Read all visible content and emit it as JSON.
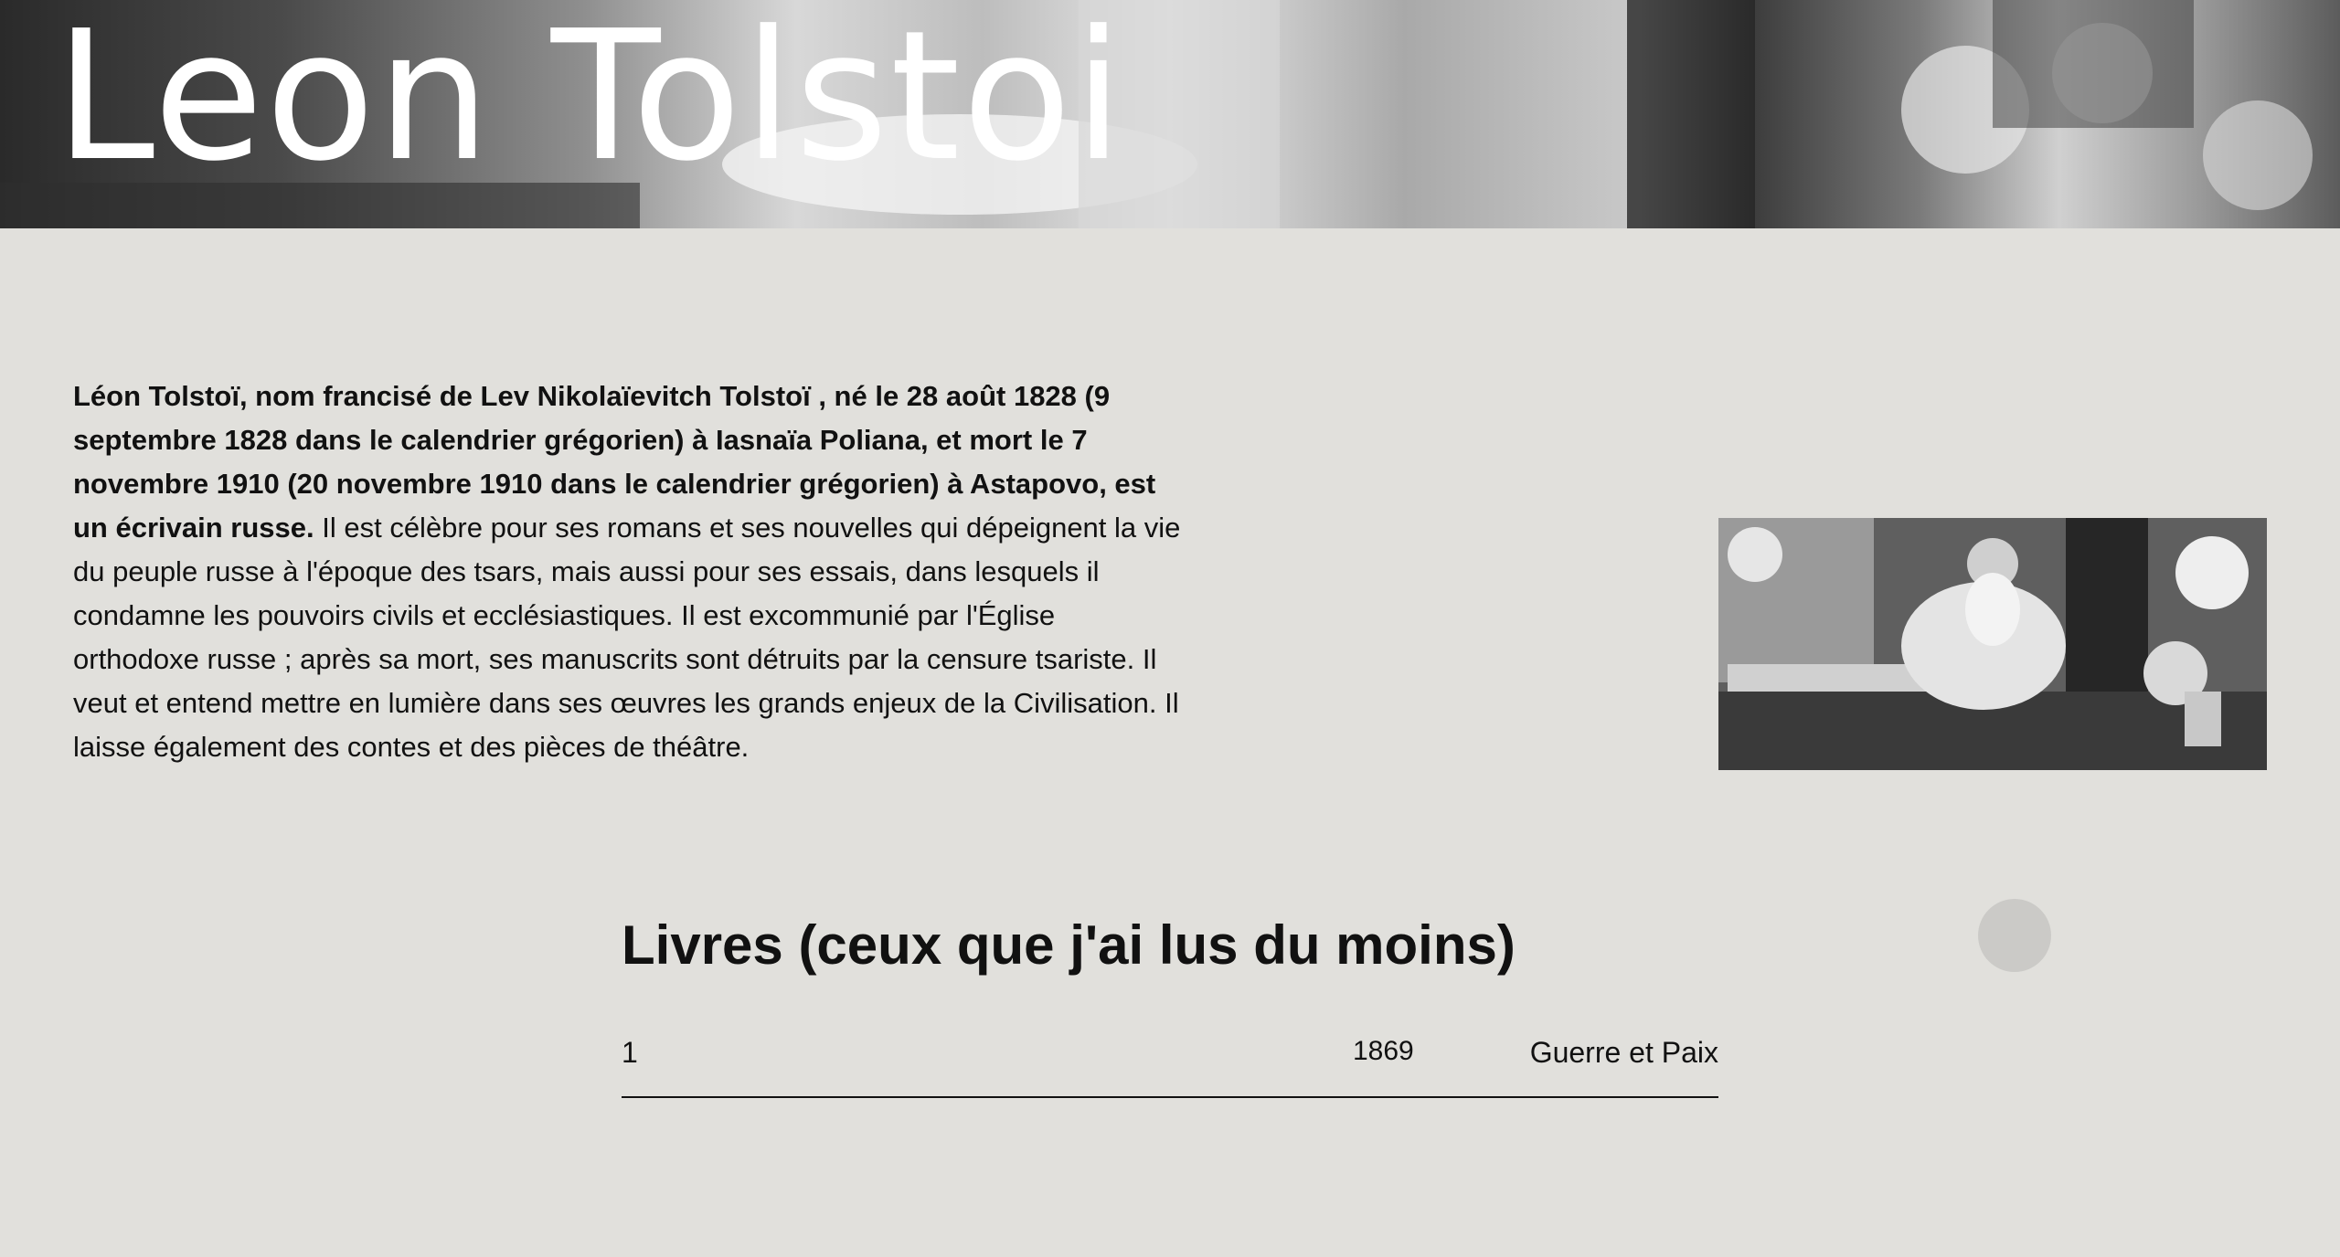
{
  "hero": {
    "title": "Leon Tolstoi"
  },
  "bio": {
    "intro_bold": "Léon Tolstoï, nom francisé de Lev Nikolaïevitch Tolstoï , né le 28 août 1828 (9 septembre 1828 dans le calendrier grégorien) à Iasnaïa Poliana, et mort le 7 novembre 1910 (20 novembre 1910 dans le calendrier grégorien) à Astapovo, est un écrivain russe.",
    "body": " Il est célèbre pour ses romans et ses nouvelles qui dépeignent la vie du peuple russe à l'époque des tsars, mais aussi pour ses essais, dans lesquels il condamne les pouvoirs civils et ecclésiastiques. Il est excommunié par l'Église orthodoxe russe ; après sa mort, ses manuscrits sont détruits par la censure tsariste. Il veut et entend mettre en lumière dans ses œuvres les grands enjeux de la Civilisation. Il laisse également des contes et des pièces de théâtre."
  },
  "books": {
    "heading": "Livres (ceux que j'ai lus du moins)",
    "items": [
      {
        "index": "1",
        "year": "1869",
        "title": "Guerre et Paix"
      }
    ]
  },
  "colors": {
    "background": "#e1e0dc",
    "text": "#111111",
    "hero_text": "#ffffff",
    "scroll_dot": "#cbcac7"
  }
}
